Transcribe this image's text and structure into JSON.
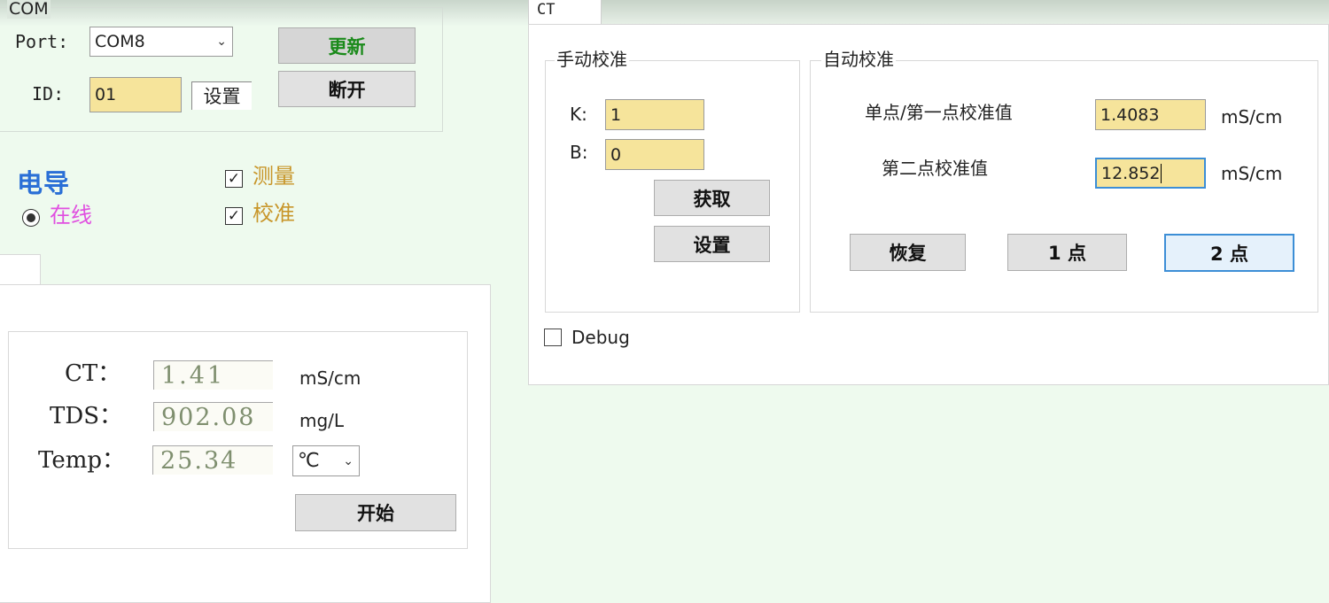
{
  "com": {
    "legend": "COM",
    "port_label": "Port:",
    "port_value": "COM8",
    "id_label": "ID:",
    "id_value": "01",
    "set_label": "设置",
    "update_label": "更新",
    "disconnect_label": "断开"
  },
  "modes": {
    "title": "电导",
    "online_label": "在线",
    "measure_label": "测量",
    "calibrate_label": "校准"
  },
  "readings": {
    "ct_label": "CT：",
    "ct_value": "1.41",
    "ct_unit": "mS/cm",
    "tds_label": "TDS：",
    "tds_value": "902.08",
    "tds_unit": "mg/L",
    "temp_label": "Temp：",
    "temp_value": "25.34",
    "temp_unit_selected": "℃",
    "start_label": "开始"
  },
  "ct_tab": {
    "tab_label": "CT",
    "manual": {
      "legend": "手动校准",
      "k_label": "K:",
      "k_value": "1",
      "b_label": "B:",
      "b_value": "0",
      "get_label": "获取",
      "set_label": "设置"
    },
    "auto": {
      "legend": "自动校准",
      "point1_label": "单点/第一点校准值",
      "point1_value": "1.4083",
      "point1_unit": "mS/cm",
      "point2_label": "第二点校准值",
      "point2_value": "12.852",
      "point2_unit": "mS/cm",
      "restore_label": "恢复",
      "one_point_label": "1 点",
      "two_point_label": "2 点"
    },
    "debug_label": "Debug"
  },
  "colors": {
    "background": "#eefaee",
    "input_fill": "#f6e49b",
    "update_text": "#1a8a1a",
    "title_blue": "#2a6fd6",
    "online_magenta": "#e050e0",
    "option_gold": "#c8962a",
    "focus_border": "#3c8ed6"
  },
  "icons": {
    "dropdown": "chevron-down-icon",
    "checkmark": "checkmark-icon",
    "radio": "radio-selected-icon"
  }
}
